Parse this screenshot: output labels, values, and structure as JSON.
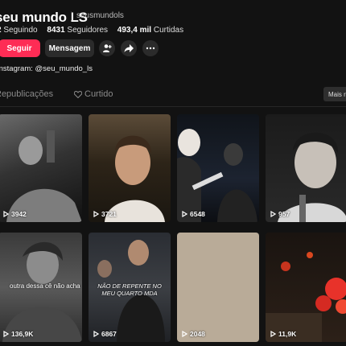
{
  "profile": {
    "display_name": "seu mundo LS",
    "username": "seusmundols",
    "following_count": "2",
    "following_label": "Seguindo",
    "followers_count": "8431",
    "followers_label": "Seguidores",
    "likes_count": "493,4 mil",
    "likes_label": "Curtidas",
    "bio": "Instagram: @seu_mundo_ls"
  },
  "actions": {
    "follow_label": "Seguir",
    "message_label": "Mensagem",
    "accent": "#fe2c55"
  },
  "tabs": [
    {
      "label": "Republicações",
      "icon": "repost-icon"
    },
    {
      "label": "Curtido",
      "icon": "heart-icon"
    }
  ],
  "sort_button": "Mais re",
  "videos": [
    {
      "views": "3942",
      "caption": ""
    },
    {
      "views": "3721",
      "caption": ""
    },
    {
      "views": "6548",
      "caption": ""
    },
    {
      "views": "957",
      "caption": ""
    },
    {
      "views": "136,9K",
      "caption": "outra dessa cê não acha"
    },
    {
      "views": "6867",
      "caption": "NÃO DE REPENTE NO MEU QUARTO MDA"
    },
    {
      "views": "2048",
      "caption": ""
    },
    {
      "views": "11,9K",
      "caption": ""
    }
  ]
}
